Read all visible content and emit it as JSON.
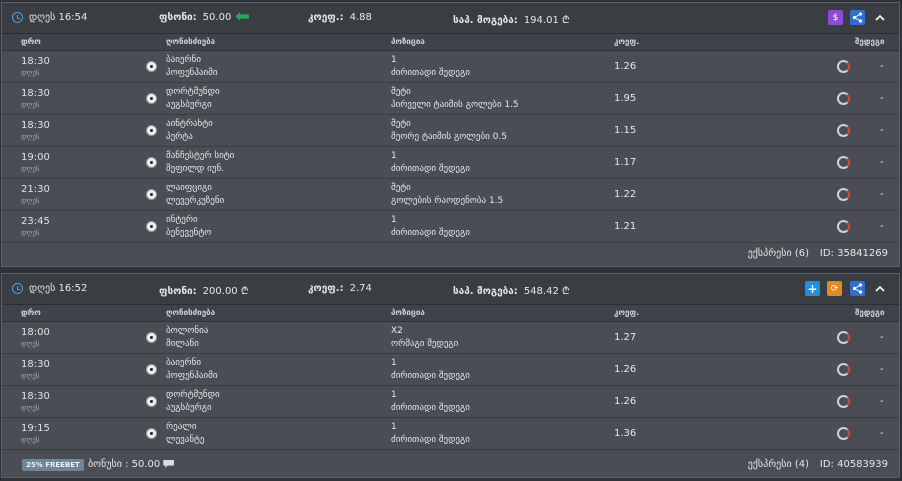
{
  "columns": {
    "date": "დრო",
    "event": "ღონისძიება",
    "market": "პოზიცია",
    "odds": "კოეფ.",
    "result": "შედეგი"
  },
  "tickets": [
    {
      "datetime": "დღეს 16:54",
      "stake_label": "ფსონი:",
      "stake_value": "50.00",
      "odds_label": "კოეფ.:",
      "odds_value": "4.88",
      "payout_label": "საპ. მოგება:",
      "payout_value": "194.01 ₾",
      "rows": [
        {
          "time": "18:30",
          "day": "დღეს",
          "team1": "ბაიერნი",
          "team2": "პოფენჰაიმი",
          "pick": "1",
          "market": "ძირითადი შედეგი",
          "odds": "1.26",
          "result": "-"
        },
        {
          "time": "18:30",
          "day": "დღეს",
          "team1": "დორტმუნდი",
          "team2": "აუგსბურგი",
          "pick": "მეტი",
          "market": "პირველი ტაიმის გოლები 1.5",
          "odds": "1.95",
          "result": "-"
        },
        {
          "time": "18:30",
          "day": "დღეს",
          "team1": "აინტრახტი",
          "team2": "პერტა",
          "pick": "მეტი",
          "market": "მეორე ტაიმის გოლები 0.5",
          "odds": "1.15",
          "result": "-"
        },
        {
          "time": "19:00",
          "day": "დღეს",
          "team1": "მანჩესტერ სიტი",
          "team2": "შეფილდ იუნ.",
          "pick": "1",
          "market": "ძირითადი შედეგი",
          "odds": "1.17",
          "result": "-"
        },
        {
          "time": "21:30",
          "day": "დღეს",
          "team1": "ლაიფციგი",
          "team2": "ლევერკუზენი",
          "pick": "მეტი",
          "market": "გოლების რაოდენობა 1.5",
          "odds": "1.22",
          "result": "-"
        },
        {
          "time": "23:45",
          "day": "დღეს",
          "team1": "ინტერი",
          "team2": "ბენევენტო",
          "pick": "1",
          "market": "ძირითადი შედეგი",
          "odds": "1.21",
          "result": "-"
        }
      ],
      "express": "ექსპრესი (6)",
      "id": "ID: 35841269"
    },
    {
      "datetime": "დღეს 16:52",
      "stake_label": "ფსონი:",
      "stake_value": "200.00 ₾",
      "odds_label": "კოეფ.:",
      "odds_value": "2.74",
      "payout_label": "საპ. მოგება:",
      "payout_value": "548.42 ₾",
      "rows": [
        {
          "time": "18:00",
          "day": "დღეს",
          "team1": "ბოლონია",
          "team2": "მილანი",
          "pick": "X2",
          "market": "ორმაგი შედეგი",
          "odds": "1.27",
          "result": "-"
        },
        {
          "time": "18:30",
          "day": "დღეს",
          "team1": "ბაიერნი",
          "team2": "პოფენჰაიმი",
          "pick": "1",
          "market": "ძირითადი შედეგი",
          "odds": "1.26",
          "result": "-"
        },
        {
          "time": "18:30",
          "day": "დღეს",
          "team1": "დორტმუნდი",
          "team2": "აუგსბურგი",
          "pick": "1",
          "market": "ძირითადი შედეგი",
          "odds": "1.26",
          "result": "-"
        },
        {
          "time": "19:15",
          "day": "დღეს",
          "team1": "რეალი",
          "team2": "ლევანტე",
          "pick": "1",
          "market": "ძირითადი შედეგი",
          "odds": "1.36",
          "result": "-"
        }
      ],
      "freebet": "25% FREEBET",
      "bonus_label": "ბონუსი :",
      "bonus_value": "50.00",
      "express": "ექსპრესი (4)",
      "id": "ID: 40583939"
    }
  ],
  "colors": {
    "card": "#4a4d53",
    "header": "#3a3d42",
    "accent_blue": "#4aa3df",
    "cash_green": "#2e9e5b",
    "btn_purple": "#8e4bd6",
    "btn_blue": "#1f8fe0",
    "btn_orange": "#e08a1f",
    "btn_share": "#2f6fd1"
  },
  "icons": [
    "clock-icon",
    "cash-icon",
    "dollar-icon",
    "share-icon",
    "plus-icon",
    "refresh-icon",
    "chevron-up-icon",
    "football-icon",
    "status-spinner-icon",
    "chat-icon"
  ]
}
